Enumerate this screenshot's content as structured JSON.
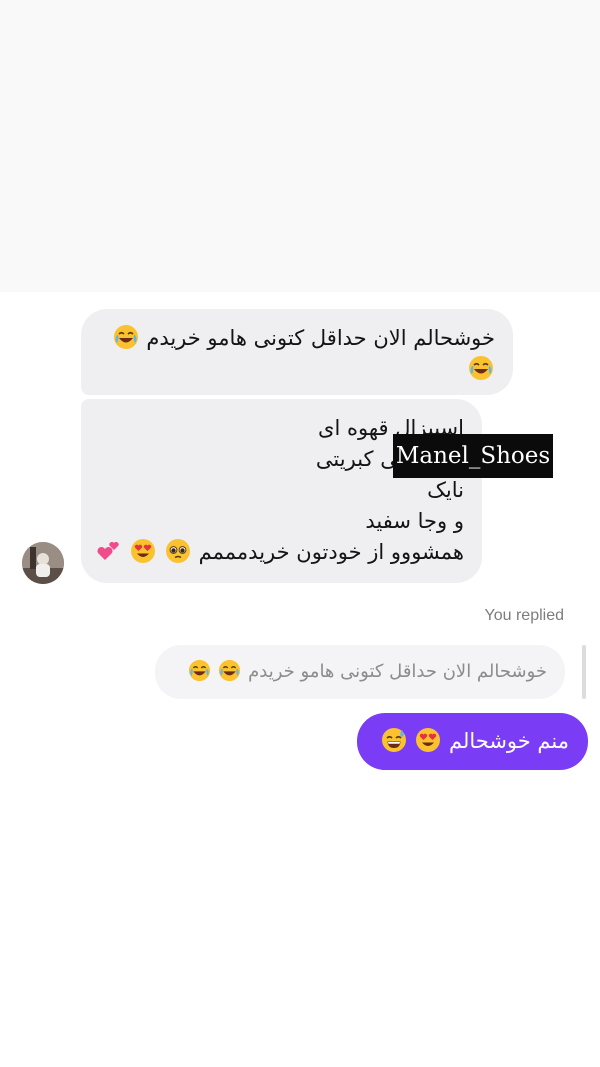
{
  "conversation": {
    "incoming": {
      "message_1": {
        "line_1": "خوشحالم الان حداقل کتونی هامو خریدم",
        "emojis": [
          "face-with-tears-of-joy",
          "face-with-tears-of-joy"
        ]
      },
      "message_2": {
        "lines": [
          "اسپیزال قهوه ای",
          "و زرشکی کبریتی",
          "نایک",
          "و وجا سفید",
          "همشووو از خودتون خریدمممم"
        ],
        "emojis": [
          "pleading-face",
          "smiling-face-with-heart-eyes",
          "two-hearts"
        ]
      }
    },
    "watermark": "Manel_Shoes",
    "replied_label": "You replied",
    "quoted_message": {
      "text": "خوشحالم الان حداقل کتونی هامو خریدم",
      "emojis": [
        "face-with-tears-of-joy",
        "face-with-tears-of-joy"
      ]
    },
    "outgoing": {
      "text": "منم خوشحالم",
      "emojis": [
        "smiling-face-with-heart-eyes",
        "grinning-face-with-sweat"
      ]
    }
  },
  "colors": {
    "incoming_bubble": "#efeff1",
    "outgoing_bubble": "#7a3cf5",
    "quoted_bubble": "#f4f4f6",
    "top_background": "#f9f9fa"
  }
}
